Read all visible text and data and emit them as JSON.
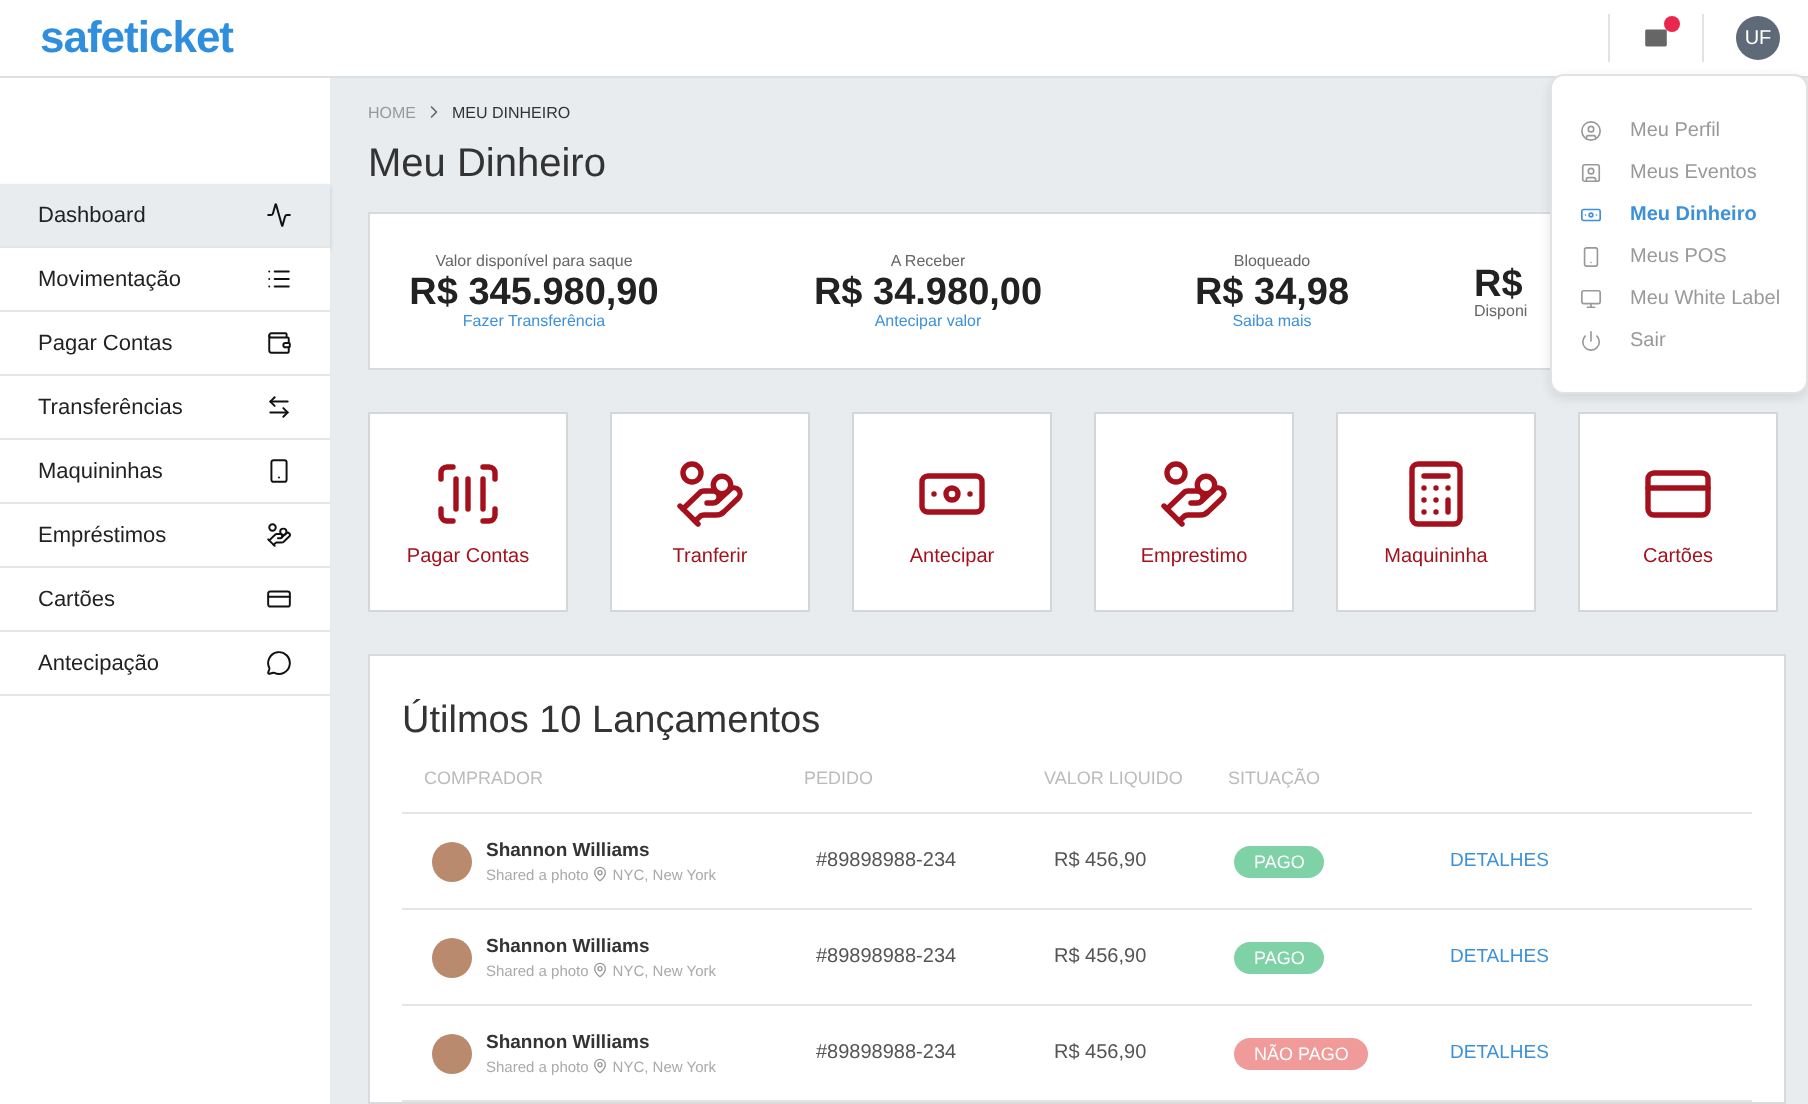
{
  "header": {
    "logo": "safeticket",
    "notifications": {
      "unread": true
    },
    "avatar": {
      "initials": "UF"
    }
  },
  "user_menu": {
    "items": [
      {
        "label": "Meu Perfil",
        "selected": false
      },
      {
        "label": "Meus Eventos",
        "selected": false
      },
      {
        "label": "Meu Dinheiro",
        "selected": true
      },
      {
        "label": "Meus POS",
        "selected": false
      },
      {
        "label": "Meu White Label",
        "selected": false
      },
      {
        "label": "Sair",
        "selected": false
      }
    ]
  },
  "sidebar": {
    "items": [
      {
        "label": "Dashboard",
        "selected": true
      },
      {
        "label": "Movimentação",
        "selected": false
      },
      {
        "label": "Pagar Contas",
        "selected": false
      },
      {
        "label": "Transferências",
        "selected": false
      },
      {
        "label": "Maquininhas",
        "selected": false
      },
      {
        "label": "Empréstimos",
        "selected": false
      },
      {
        "label": "Cartões",
        "selected": false
      },
      {
        "label": "Antecipação",
        "selected": false
      }
    ]
  },
  "breadcrumb": [
    "HOME",
    "MEU DINHEIRO"
  ],
  "page_title": "Meu Dinheiro",
  "balances": [
    {
      "label": "Valor disponível para saque",
      "value": "R$ 345.980,90",
      "link": "Fazer Transferência"
    },
    {
      "label": "A Receber",
      "value": "R$ 34.980,00",
      "link": "Antecipar valor"
    },
    {
      "label": "Bloqueado",
      "value": "R$ 34,98",
      "link": "Saiba mais"
    },
    {
      "value": "R$",
      "note": "Disponi"
    }
  ],
  "shortcuts": [
    {
      "label": "Pagar Contas"
    },
    {
      "label": "Tranferir"
    },
    {
      "label": "Antecipar"
    },
    {
      "label": "Emprestimo"
    },
    {
      "label": "Maquininha"
    },
    {
      "label": "Cartões"
    }
  ],
  "transactions": {
    "title": "Útilmos 10 Lançamentos",
    "columns": [
      "COMPRADOR",
      "PEDIDO",
      "VALOR LIQUIDO",
      "SITUAÇÃO"
    ],
    "rows": [
      {
        "name": "Shannon Williams",
        "subtitle": "Shared a photo",
        "location": "NYC, New York",
        "order": "#89898988-234",
        "amount": "R$ 456,90",
        "status": "PAGO",
        "paid": true,
        "action": "DETALHES"
      },
      {
        "name": "Shannon Williams",
        "subtitle": "Shared a photo",
        "location": "NYC, New York",
        "order": "#89898988-234",
        "amount": "R$ 456,90",
        "status": "PAGO",
        "paid": true,
        "action": "DETALHES"
      },
      {
        "name": "Shannon Williams",
        "subtitle": "Shared a photo",
        "location": "NYC, New York",
        "order": "#89898988-234",
        "amount": "R$ 456,90",
        "status": "NÃO PAGO",
        "paid": false,
        "action": "DETALHES"
      }
    ]
  }
}
